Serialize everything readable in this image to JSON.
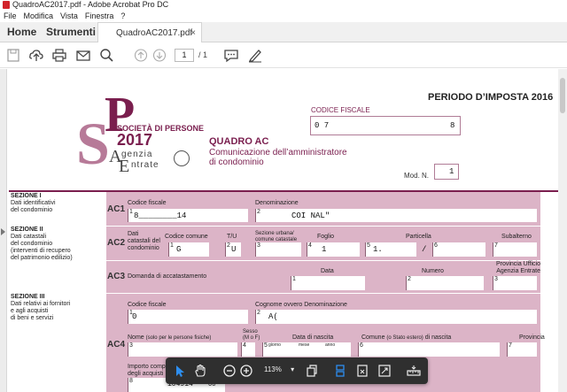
{
  "window": {
    "title": "QuadroAC2017.pdf - Adobe Acrobat Pro DC"
  },
  "menu": [
    "File",
    "Modifica",
    "Vista",
    "Finestra",
    "?"
  ],
  "tabs": {
    "home": "Home",
    "tools": "Strumenti",
    "document": "QuadroAC2017.pdf",
    "close": "×"
  },
  "toolbar": {
    "page_current": "1",
    "page_total": "/ 1"
  },
  "floating": {
    "zoom": "113%",
    "zoom_caret": "▾"
  },
  "form": {
    "logo": {
      "s": "S",
      "p": "P",
      "line1": "SOCIETÀ DI PERSONE",
      "year": "2017",
      "agency1": "genzia",
      "agency2": "ntrate",
      "agencyA": "A",
      "agencyE": "E"
    },
    "periodo": "PERIODO D’IMPOSTA 2016",
    "codice_fiscale_label": "CODICE FISCALE",
    "codice_fiscale_start": "0  7",
    "codice_fiscale_end": "8",
    "quadro_title": "QUADRO AC",
    "quadro_sub1": "Comunicazione dell’amministratore",
    "quadro_sub2": "di condominio",
    "mod_n_label": "Mod. N.",
    "mod_n_value": "1",
    "sez1": {
      "title": "SEZIONE I",
      "desc1": "Dati identificativi",
      "desc2": "del condominio",
      "code": "AC1",
      "cf_label": "Codice fiscale",
      "cf_value": "8________14",
      "den_label": "Denominazione",
      "den_value": "COI                        NAL\"",
      "n1": "1",
      "n2": "2"
    },
    "sez2": {
      "title": "SEZIONE II",
      "desc1": "Dati catastali",
      "desc2": "del condominio",
      "desc3": "(interventi di recupero",
      "desc4": "del patrimonio edilizio)",
      "code": "AC2",
      "dati_label1": "Dati",
      "dati_label2": "catastali del",
      "dati_label3": "condominio",
      "comune_label": "Codice comune",
      "comune_value": "G  ",
      "tu_label": "T/U",
      "tu_value": "U",
      "sezione_label1": "Sezione urbana/",
      "sezione_label2": "comune catastale",
      "foglio_label": "Foglio",
      "foglio_value": "1",
      "particella_label": "Particella",
      "particella_value": "1.",
      "slash": "/",
      "subalterno_label": "Subalterno",
      "n1": "1",
      "n2": "2",
      "n3": "3",
      "n4": "4",
      "n5": "5",
      "n6": "6",
      "n7": "7"
    },
    "sez2b": {
      "code": "AC3",
      "domanda_label": "Domanda di accatastamento",
      "data_label": "Data",
      "numero_label": "Numero",
      "provincia_label1": "Provincia Ufficio",
      "provincia_label2": "Agenzia Entrate",
      "n1": "1",
      "n2": "2",
      "n3": "3"
    },
    "sez3": {
      "title": "SEZIONE III",
      "desc1": "Dati relativi ai fornitori",
      "desc2": "e agli acquisti",
      "desc3": "di beni e servizi",
      "code": "AC4",
      "cf_label": "Codice fiscale",
      "cf_value": "0",
      "cogn_label": "Cognome ovvero Denominazione",
      "cogn_value": "A(",
      "nome_label": "Nome",
      "nome_note": "(solo per le persone fisiche)",
      "sesso_label": "Sesso",
      "sesso_note": "(M o F)",
      "nascita_label": "Data di nascita",
      "giorno": "giorno",
      "mese": "mese",
      "anno": "anno",
      "comune_label": "Comune",
      "comune_note": "(o Stato estero)",
      "comune_tail": "di nascita",
      "provincia_label": "Provincia",
      "importo_label1": "Importo comp",
      "importo_label2": "degli acquisti",
      "importo_value": "104914",
      "importo_cents": "00",
      "n1": "1",
      "n2": "2",
      "n3": "3",
      "n4": "4",
      "n5": "5",
      "n6": "6",
      "n7": "7",
      "n8": "8"
    }
  }
}
